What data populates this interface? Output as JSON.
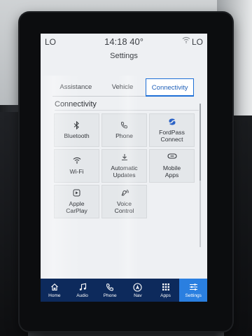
{
  "status": {
    "left": "LO",
    "time": "14:18  40°",
    "right": "LO"
  },
  "title": "Settings",
  "tabs": [
    {
      "label": "Assistance",
      "active": false
    },
    {
      "label": "Vehicle",
      "active": false
    },
    {
      "label": "Connectivity",
      "active": true
    }
  ],
  "section": "Connectivity",
  "tiles": [
    {
      "label": "Bluetooth",
      "icon": "bluetooth-icon"
    },
    {
      "label": "Phone",
      "icon": "phone-icon"
    },
    {
      "label": "FordPass\nConnect",
      "icon": "fordpass-icon"
    },
    {
      "label": "Wi-Fi",
      "icon": "wifi-icon"
    },
    {
      "label": "Automatic\nUpdates",
      "icon": "download-icon"
    },
    {
      "label": "Mobile\nApps",
      "icon": "link-icon"
    },
    {
      "label": "Apple\nCarPlay",
      "icon": "carplay-icon"
    },
    {
      "label": "Voice\nControl",
      "icon": "voice-icon"
    }
  ],
  "nav": [
    {
      "label": "Home",
      "icon": "home-icon"
    },
    {
      "label": "Audio",
      "icon": "music-icon"
    },
    {
      "label": "Phone",
      "icon": "phone-icon"
    },
    {
      "label": "Nav",
      "icon": "navigation-icon"
    },
    {
      "label": "Apps",
      "icon": "apps-grid-icon"
    },
    {
      "label": "Settings",
      "icon": "settings-sliders-icon",
      "active": true
    }
  ],
  "colors": {
    "accent": "#1e6fd6",
    "navbar": "#0d2a5c",
    "nav_active": "#2a7fe0"
  }
}
